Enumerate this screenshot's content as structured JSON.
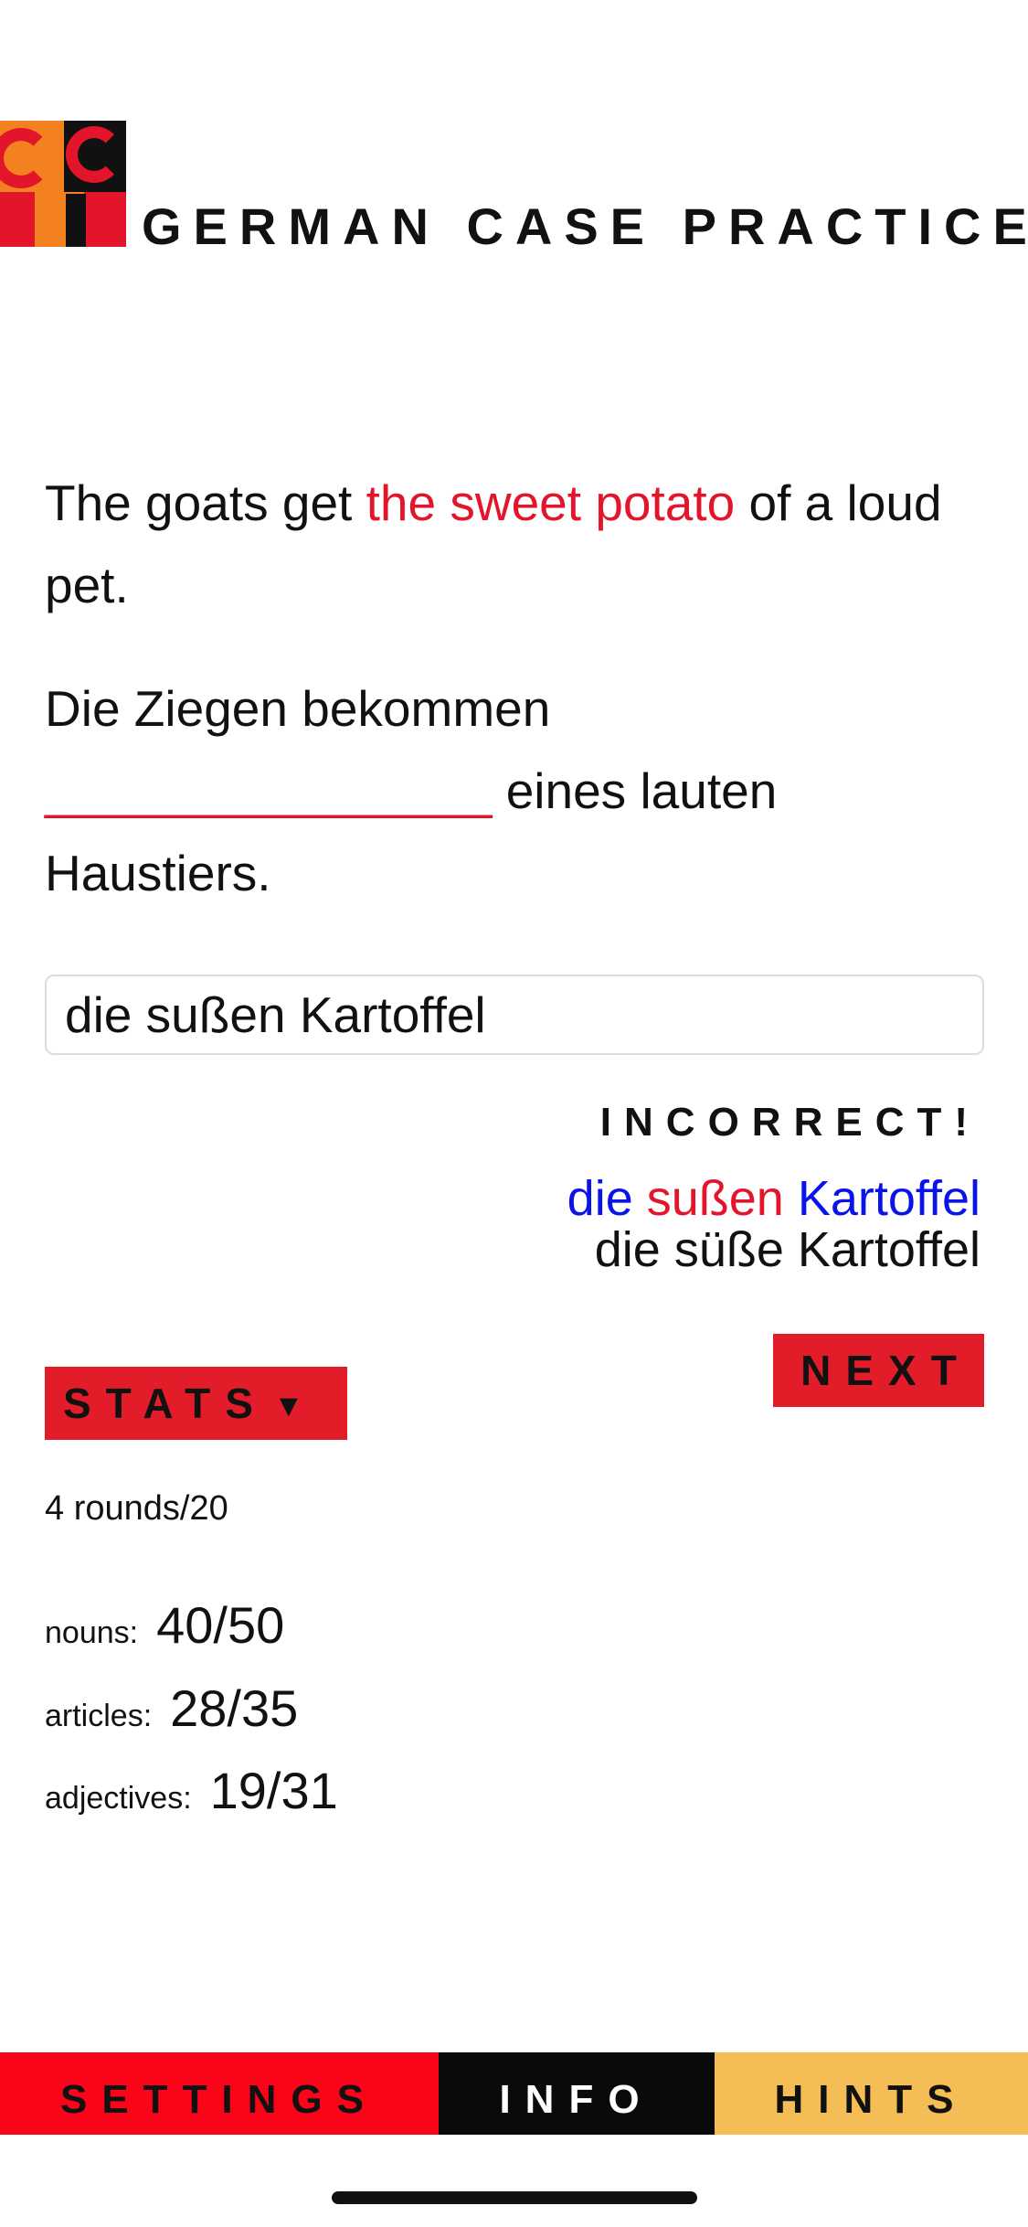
{
  "app": {
    "title": "GERMAN CASE PRACTICE"
  },
  "colors": {
    "accent_red": "#e3152b",
    "logo_orange": "#f4811f",
    "correct_blue": "#0a14e8",
    "hints_yellow": "#f5bd55",
    "info_black": "#0a0a0a"
  },
  "exercise": {
    "english_before": "The goats get ",
    "english_highlight": "the sweet potato",
    "english_after": " of a loud pet.",
    "german_before": "Die Ziegen bekommen ",
    "german_blank": "________________",
    "german_after": " eines lauten Haustiers."
  },
  "answer": {
    "value": "die sußen Kartoffel"
  },
  "feedback": {
    "verdict": "INCORRECT!",
    "your_answer_parts": [
      {
        "text": "die",
        "status": "correct"
      },
      {
        "text": "sußen",
        "status": "wrong"
      },
      {
        "text": "Kartoffel",
        "status": "correct"
      }
    ],
    "correct_answer": "die süße Kartoffel"
  },
  "buttons": {
    "next": "NEXT",
    "stats": "STATS",
    "stats_arrow": "▼"
  },
  "stats": {
    "rounds": "4 rounds/20",
    "rows": [
      {
        "label": "nouns:",
        "value": "40/50"
      },
      {
        "label": "articles:",
        "value": "28/35"
      },
      {
        "label": "adjectives:",
        "value": "19/31"
      }
    ]
  },
  "tabs": [
    {
      "label": "SETTINGS"
    },
    {
      "label": "INFO"
    },
    {
      "label": "HINTS"
    }
  ]
}
